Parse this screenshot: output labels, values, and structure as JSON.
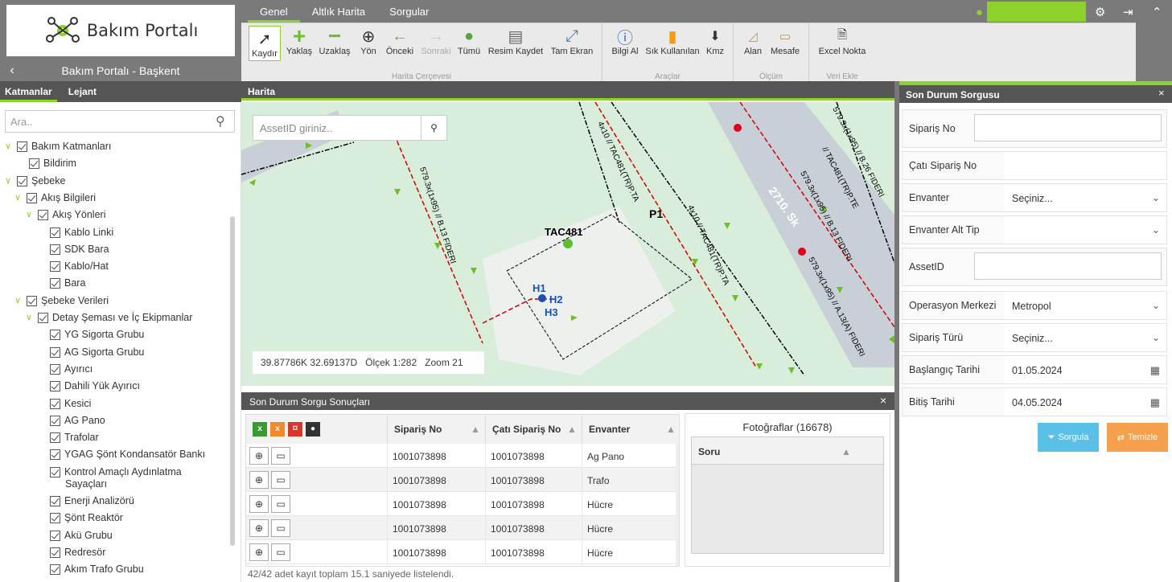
{
  "app": {
    "logo_text": "Bakım Portalı",
    "subtitle": "Bakım Portalı - Başkent",
    "back_icon": "chevron-left-icon"
  },
  "tabs": [
    "Genel",
    "Altlık Harita",
    "Sorgular"
  ],
  "ribbon": {
    "groups": [
      {
        "label": "Harita Çerçevesi",
        "buttons": [
          "Kaydır",
          "Yaklaş",
          "Uzaklaş",
          "Yön",
          "Önceki",
          "Sonraki",
          "Tümü",
          "Resim Kaydet",
          "Tam Ekran"
        ]
      },
      {
        "label": "Araçlar",
        "buttons": [
          "Bilgi Al",
          "Sık Kullanılan",
          "Kmz"
        ]
      },
      {
        "label": "Ölçüm",
        "buttons": [
          "Alan",
          "Mesafe"
        ]
      },
      {
        "label": "Veri Ekle",
        "buttons": [
          "Excel Nokta"
        ]
      }
    ],
    "accent": "#8cd12c"
  },
  "left_panel": {
    "tabs": [
      "Katmanlar",
      "Lejant"
    ],
    "search_placeholder": "Ara..",
    "tree": [
      "Bakım Katmanları",
      "Bildirim",
      "Şebeke",
      "Akış Bilgileri",
      "Akış Yönleri",
      "Kablo Linki",
      "SDK Bara",
      "Kablo/Hat",
      "Bara",
      "Şebeke Verileri",
      "Detay Şeması ve İç Ekipmanlar",
      "YG Sigorta Grubu",
      "AG Sigorta Grubu",
      "Ayırıcı",
      "Dahili Yük Ayırıcı",
      "Kesici",
      "AG Pano",
      "Trafolar",
      "YGAG Şönt Kondansatör Bankı",
      "Kontrol Amaçlı Aydınlatma",
      "Sayaçları",
      "Enerji Analizörü",
      "Şönt Reaktör",
      "Akü Grubu",
      "Redresör",
      "Akım Trafo Grubu"
    ]
  },
  "map": {
    "header": "Harita",
    "asset_placeholder": "AssetID giriniz..",
    "coords": "39.87786K 32.69137D",
    "scale": "Ölçek 1:282",
    "zoom": "Zoom 21",
    "labels": {
      "station": "TAC481",
      "p1": "P1",
      "h1": "H1",
      "h2": "H2",
      "h3": "H3",
      "street": "2710. Sk",
      "line1": "579.3x(1x95) // B.13 FIDERI",
      "line2": "4x10 // TAC481(TR)P.TA",
      "line3": "579.3x(1x95) // B.26 FIDERI",
      "line4": "// TAC481(TR)P.TE",
      "line5": "579.3x(1x95) // B.13 FIDERI",
      "line6": "579.3x(1x95) // A.13(A) FIDERI",
      "line7": "4x10 // TAC481(TR)P.TA"
    }
  },
  "results": {
    "header": "Son Durum Sorgu Sonuçları",
    "columns": [
      "Sipariş No",
      "Çatı Sipariş No",
      "Envanter"
    ],
    "rows": [
      {
        "siparis": "1001073898",
        "cati": "1001073898",
        "envanter": "Ag Pano"
      },
      {
        "siparis": "1001073898",
        "cati": "1001073898",
        "envanter": "Trafo"
      },
      {
        "siparis": "1001073898",
        "cati": "1001073898",
        "envanter": "Hücre"
      },
      {
        "siparis": "1001073898",
        "cati": "1001073898",
        "envanter": "Hücre"
      },
      {
        "siparis": "1001073898",
        "cati": "1001073898",
        "envanter": "Hücre"
      }
    ],
    "status": "42/42 adet kayıt toplam 15.1 saniyede listelendi.",
    "photos_title": "Fotoğraflar (16678)",
    "photos_col": "Soru"
  },
  "query": {
    "header": "Son Durum Sorgusu",
    "fields": [
      {
        "label": "Sipariş No",
        "value": ""
      },
      {
        "label": "Çatı Sipariş No",
        "value": ""
      },
      {
        "label": "Envanter",
        "value": "Seçiniz..."
      },
      {
        "label": "Envanter Alt Tip",
        "value": ""
      },
      {
        "label": "AssetID",
        "value": ""
      },
      {
        "label": "Operasyon Merkezi",
        "value": "Metropol"
      },
      {
        "label": "Sipariş Türü",
        "value": "Seçiniz..."
      },
      {
        "label": "Başlangıç Tarihi",
        "value": "01.05.2024"
      },
      {
        "label": "Bitiş Tarihi",
        "value": "04.05.2024"
      }
    ],
    "query_button": "Sorgula",
    "clear_button": "Temizle",
    "query_color": "#5bc0e8",
    "clear_color": "#f6a04d"
  }
}
